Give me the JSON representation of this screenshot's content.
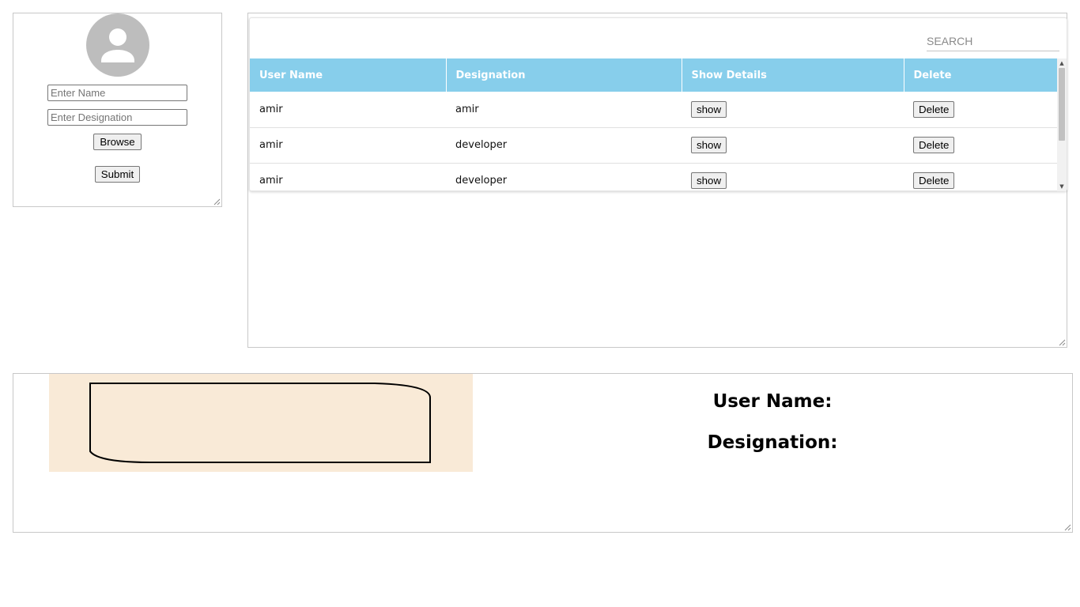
{
  "form": {
    "name_placeholder": "Enter Name",
    "designation_placeholder": "Enter Designation",
    "browse_label": "Browse",
    "submit_label": "Submit"
  },
  "table": {
    "search_placeholder": "SEARCH",
    "header_color": "#87ceeb",
    "columns": [
      "User Name",
      "Designation",
      "Show Details",
      "Delete"
    ],
    "rows": [
      {
        "user_name": "amir",
        "designation": "amir",
        "show_label": "show",
        "delete_label": "Delete"
      },
      {
        "user_name": "amir",
        "designation": "developer",
        "show_label": "show",
        "delete_label": "Delete"
      },
      {
        "user_name": "amir",
        "designation": "developer",
        "show_label": "show",
        "delete_label": "Delete"
      }
    ]
  },
  "details": {
    "user_name_label": "User Name:",
    "designation_label": "Designation:",
    "image_background_color": "#f9ead7"
  }
}
